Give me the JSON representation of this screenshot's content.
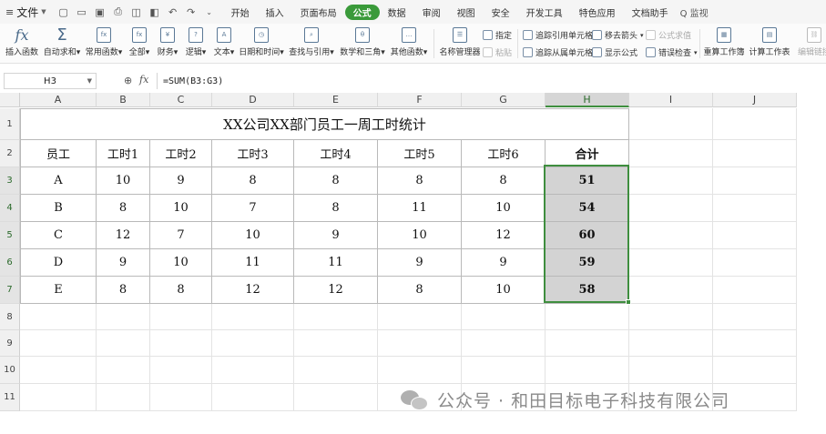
{
  "menubar": {
    "file": "文件",
    "tabs": [
      "开始",
      "插入",
      "页面布局",
      "公式",
      "数据",
      "审阅",
      "视图",
      "安全",
      "开发工具",
      "特色应用",
      "文档助手"
    ],
    "active_tab": "公式",
    "search": "Q 监视"
  },
  "ribbon": {
    "insert_function": "插入函数",
    "autosum": "自动求和",
    "common_functions": "常用函数",
    "all": "全部",
    "finance": "财务",
    "logic": "逻辑",
    "text": "文本",
    "datetime": "日期和时间",
    "lookup": "查找与引用",
    "math_trig": "数学和三角",
    "other_functions": "其他函数",
    "name_manager": "名称管理器",
    "define": "指定",
    "paste": "粘贴",
    "trace_precedents": "追踪引用单元格",
    "trace_dependents": "追踪从属单元格",
    "remove_arrows": "移去箭头",
    "show_formulas": "显示公式",
    "evaluate_formula": "公式求值",
    "error_checking": "错误检查",
    "recalc_workbook": "重算工作簿",
    "calc_sheet": "计算工作表",
    "edit_links": "编辑链接"
  },
  "formula_bar": {
    "name_box": "H3",
    "fx": "fx",
    "formula": "=SUM(B3:G3)"
  },
  "sheet": {
    "columns": [
      "A",
      "B",
      "C",
      "D",
      "E",
      "F",
      "G",
      "H",
      "I",
      "J"
    ],
    "rows": [
      "1",
      "2",
      "3",
      "4",
      "5",
      "6",
      "7",
      "8",
      "9",
      "10",
      "11"
    ],
    "title": "XX公司XX部门员工一周工时统计",
    "headers": [
      "员工",
      "工时1",
      "工时2",
      "工时3",
      "工时4",
      "工时5",
      "工时6",
      "合计"
    ],
    "data": [
      [
        "A",
        "10",
        "9",
        "8",
        "8",
        "8",
        "8",
        "51"
      ],
      [
        "B",
        "8",
        "10",
        "7",
        "8",
        "11",
        "10",
        "54"
      ],
      [
        "C",
        "12",
        "7",
        "10",
        "9",
        "10",
        "12",
        "60"
      ],
      [
        "D",
        "9",
        "10",
        "11",
        "11",
        "9",
        "9",
        "59"
      ],
      [
        "E",
        "8",
        "8",
        "12",
        "12",
        "8",
        "10",
        "58"
      ]
    ],
    "selected_column": "H"
  },
  "watermark": {
    "text": "公众号 · 和田目标电子科技有限公司"
  }
}
